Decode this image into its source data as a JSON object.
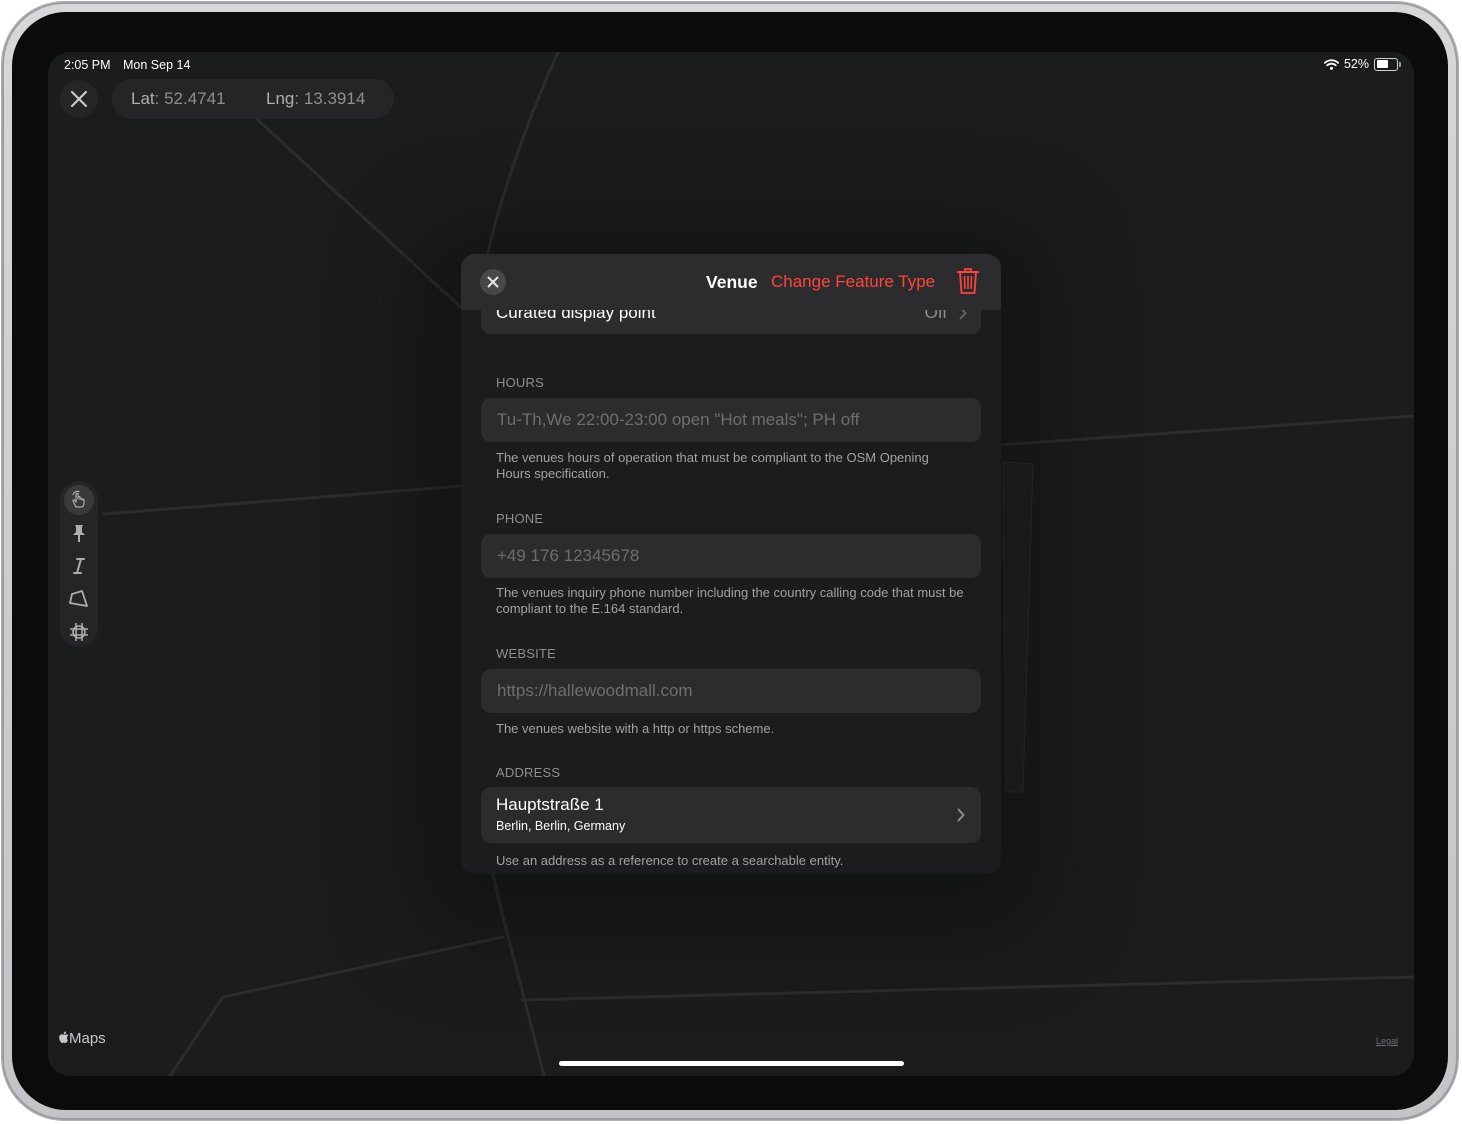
{
  "status_bar": {
    "time": "2:05 PM",
    "date": "Mon Sep 14",
    "battery": "52%",
    "wifi_icon": "wifi-icon",
    "battery_icon": "battery-icon"
  },
  "map": {
    "lat_label": "Lat",
    "lat_value": "52.4741",
    "lng_label": "Lng",
    "lng_value": "13.3914",
    "close_icon": "close-icon",
    "tools": [
      "hand-pointer-icon",
      "pin-icon",
      "text-cursor-icon",
      "polygon-icon",
      "grid-crosshair-icon"
    ],
    "attribution": "Maps",
    "legal": "Legal"
  },
  "sheet": {
    "title": "Venue",
    "change_type_label": "Change Feature Type",
    "accent_color": "#ff453a",
    "curated_display_point": {
      "label": "Curated display point",
      "value": "Off"
    },
    "hours": {
      "label": "HOURS",
      "placeholder": "Tu-Th,We 22:00-23:00 open \"Hot meals\"; PH off",
      "help": "The venues hours of operation that must be compliant to the OSM Opening Hours specification."
    },
    "phone": {
      "label": "PHONE",
      "placeholder": "+49 176 12345678",
      "help": "The venues inquiry phone number including the country calling code that must be compliant to the E.164 standard."
    },
    "website": {
      "label": "WEBSITE",
      "placeholder": "https://hallewoodmall.com",
      "help": "The venues website with a http or https scheme."
    },
    "address": {
      "label": "ADDRESS",
      "street": "Hauptstraße 1",
      "city_line": "Berlin, Berlin, Germany",
      "help": "Use an address as a reference to create a searchable entity."
    }
  }
}
